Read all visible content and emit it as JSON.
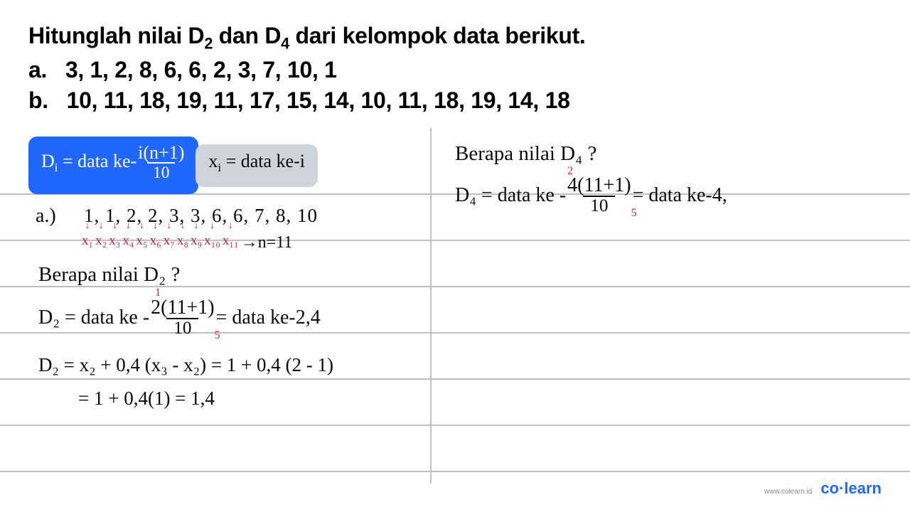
{
  "problem": {
    "title_html": "Hitunglah nilai D<sub>2</sub> dan D<sub>4</sub> dari kelompok data berikut.",
    "a_label": "a.",
    "a_data": "3, 1, 2, 8, 6, 6, 2, 3, 7, 10, 1",
    "b_label": "b.",
    "b_data": "10, 11, 18, 19, 11, 17, 15, 14, 10, 11, 18, 19, 14, 18"
  },
  "formula": {
    "di_lhs": "D<sub>i</sub> = data ke-",
    "di_num": "i(n+1)",
    "di_den": "10",
    "xi": "x<sub>i</sub> = data ke-i"
  },
  "left": {
    "a_label": "a.)",
    "sorted": "1, 1, 2, 2, 3, 3, 6, 6, 7, 8, 10",
    "xlabels": [
      "x₁",
      "x₂",
      "x₃",
      "x₄",
      "x₅",
      "x₆",
      "x₇",
      "x₈",
      "x₉",
      "x₁₀",
      "x₁₁"
    ],
    "n_eq": "→n=11",
    "q_d2": "Berapa nilai D₂ ?",
    "d2_lhs": "D₂ = data ke -",
    "d2_num": "2(11+1)",
    "d2_den": "10",
    "d2_rhs": "= data ke-2,4",
    "d2_ann_top": "1",
    "d2_ann_bot": "5",
    "d2_calc1": "D₂ = x₂ + 0,4 (x₃ - x₂) = 1 + 0,4 (2 - 1)",
    "d2_calc2": "= 1 + 0,4(1) = 1,4"
  },
  "right": {
    "q_d4": "Berapa nilai D₄ ?",
    "d4_lhs": "D₄ = data ke -",
    "d4_num": "4(11+1)",
    "d4_den": "10",
    "d4_rhs": "= data ke-4,",
    "d4_ann_top": "2",
    "d4_ann_bot": "5"
  },
  "footer": {
    "site": "www.colearn.id",
    "brand": "co·learn"
  },
  "chart_data": {
    "type": "table",
    "title": "Decile calculation (D2, D4) from raw datasets",
    "datasets": {
      "a_raw": [
        3,
        1,
        2,
        8,
        6,
        6,
        2,
        3,
        7,
        10,
        1
      ],
      "a_sorted": [
        1,
        1,
        2,
        2,
        3,
        3,
        6,
        6,
        7,
        8,
        10
      ],
      "b_raw": [
        10,
        11,
        18,
        19,
        11,
        17,
        15,
        14,
        10,
        11,
        18,
        19,
        14,
        18
      ]
    },
    "n_a": 11,
    "D2_position": 2.4,
    "D2_value": 1.4,
    "D4_position_approx": 4
  }
}
